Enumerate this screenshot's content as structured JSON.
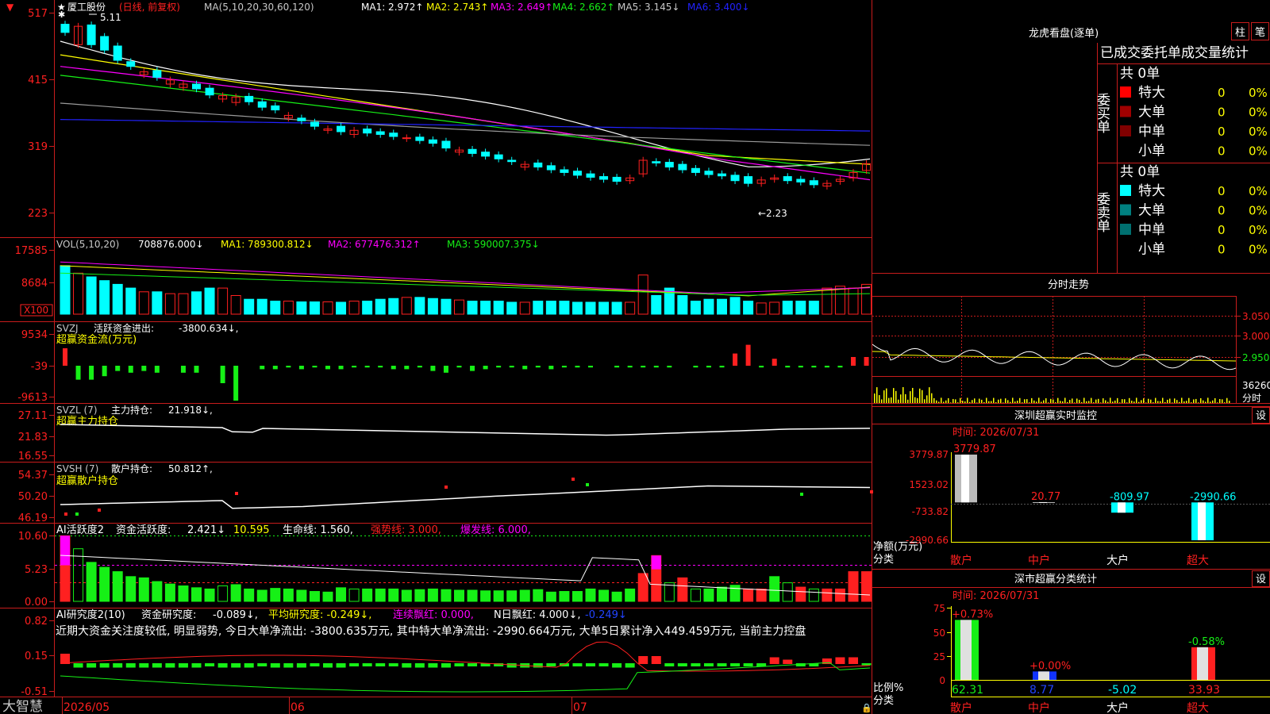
{
  "app": {
    "brand": "大智慧"
  },
  "colors": {
    "bg": "#000000",
    "grid": "#c81c1c",
    "up": "#ff2020",
    "down": "#00ffff",
    "green": "#16f016",
    "white": "#ffffff",
    "yellow": "#ffff00",
    "magenta": "#ff00ff",
    "blue": "#2222ff",
    "gray": "#9a9a9a",
    "teal": "#009090"
  },
  "price_panel": {
    "star": "★",
    "stock_name": "厦工股份",
    "period": "(日线, 前复权)",
    "ma_label": "MA(5,10,20,30,60,120)",
    "ma": [
      {
        "name": "MA1:",
        "value": "2.972",
        "arrow": "↑",
        "color": "#ffffff"
      },
      {
        "name": "MA2:",
        "value": "2.743",
        "arrow": "↑",
        "color": "#ffff00"
      },
      {
        "name": "MA3:",
        "value": "2.649",
        "arrow": "↑",
        "color": "#ff00ff"
      },
      {
        "name": "MA4:",
        "value": "2.662",
        "arrow": "↑",
        "color": "#16f016"
      },
      {
        "name": "MA5:",
        "value": "3.145",
        "arrow": "↓",
        "color": "#c8c8c8"
      },
      {
        "name": "MA6:",
        "value": "3.400",
        "arrow": "↓",
        "color": "#2222ff"
      }
    ],
    "y_ticks": [
      "517",
      "415",
      "319",
      "223"
    ],
    "high_label": "5.11",
    "low_label": "←2.23",
    "high_marker": "✱"
  },
  "vol_panel": {
    "label": "VOL(5,10,20)",
    "value": "708876.000↓",
    "ma": [
      {
        "name": "MA1:",
        "value": "789300.812↓",
        "color": "#ffff00"
      },
      {
        "name": "MA2:",
        "value": "677476.312↑",
        "color": "#ff00ff"
      },
      {
        "name": "MA3:",
        "value": "590007.375↓",
        "color": "#16f016"
      }
    ],
    "y_ticks": [
      "17585",
      "8684"
    ],
    "unit": "X100"
  },
  "svzj_panel": {
    "label": "SVZJ",
    "title": "活跃资金进出:",
    "value": "-3800.634↓,",
    "sub": "超赢资金流(万元)",
    "y_ticks": [
      "9534",
      "-39",
      "-9613"
    ]
  },
  "svzl_panel": {
    "label": "SVZL (7)",
    "title": "主力持仓:",
    "value": "21.918↓,",
    "sub": "超赢主力持仓",
    "y_ticks": [
      "27.11",
      "21.83",
      "16.55"
    ]
  },
  "svsh_panel": {
    "label": "SVSH (7)",
    "title": "散户持仓:",
    "value": "50.812↑,",
    "sub": "超赢散户持仓",
    "y_ticks": [
      "54.37",
      "50.20",
      "46.19"
    ]
  },
  "ai1_panel": {
    "label": "AI活跃度2",
    "title": "资金活跃度:",
    "v1": "2.421↓",
    "v2": "10.595",
    "life": "生命线: 1.560,",
    "strong": "强势线: 3.000,",
    "burst": "爆发线: 6.000,",
    "y_ticks": [
      "10.60",
      "5.23",
      "0.00"
    ]
  },
  "ai2_panel": {
    "label": "AI研究度2(10)",
    "title": "资金研究度:",
    "v1": "-0.089↓,",
    "avg": "平均研究度: -0.249↓,",
    "red": "连续飘红: 0.000,",
    "nred": "N日飘红: 4.000↓,",
    "tail": "-0.249↓",
    "comment": "近期大资金关注度较低, 明显弱势, 今日大单净流出: -3800.635万元, 其中特大单净流出: -2990.664万元, 大单5日累计净入449.459万元, 当前主力控盘",
    "y_ticks": [
      "0.82",
      "0.15",
      "-0.51"
    ]
  },
  "x_axis": {
    "labels": [
      "2026/05",
      "06",
      "07"
    ]
  },
  "dragon": {
    "title": "龙虎看盘(逐单)",
    "btn_bar": "柱",
    "btn_pen": "笔",
    "header": "已成交委托单成交量统计",
    "buy": {
      "label": "委买单",
      "total": "共 0单",
      "rows": [
        {
          "name": "特大",
          "qty": "0",
          "pct": "0%",
          "color": "#ff0000"
        },
        {
          "name": "大单",
          "qty": "0",
          "pct": "0%",
          "color": "#a00000"
        },
        {
          "name": "中单",
          "qty": "0",
          "pct": "0%",
          "color": "#800000"
        },
        {
          "name": "小单",
          "qty": "0",
          "pct": "0%",
          "color": ""
        }
      ]
    },
    "sell": {
      "label": "委卖单",
      "total": "共 0单",
      "rows": [
        {
          "name": "特大",
          "qty": "0",
          "pct": "0%",
          "color": "#00ffff"
        },
        {
          "name": "大单",
          "qty": "0",
          "pct": "0%",
          "color": "#008080"
        },
        {
          "name": "中单",
          "qty": "0",
          "pct": "0%",
          "color": "#007070"
        },
        {
          "name": "小单",
          "qty": "0",
          "pct": "0%",
          "color": ""
        }
      ]
    }
  },
  "intraday": {
    "title": "分时走势",
    "prices": [
      "3.050",
      "3.000",
      "2.950"
    ],
    "vol": "36260",
    "vol_label": "分时"
  },
  "sz_monitor": {
    "title": "深圳超赢实时监控",
    "btn": "设",
    "time": "时间: 2026/07/31",
    "y_ticks": [
      "3779.87",
      "1523.02",
      "-733.82",
      "-2990.66"
    ],
    "y_label": "净额(万元)",
    "x_label": "分类",
    "categories": [
      "散户",
      "中户",
      "大户",
      "超大"
    ],
    "values": [
      "3779.87",
      "20.77",
      "-809.97",
      "-2990.66"
    ]
  },
  "sz_class": {
    "title": "深市超赢分类统计",
    "btn": "设",
    "time": "时间: 2026/07/31",
    "y_ticks": [
      "75",
      "50",
      "25",
      "0"
    ],
    "y_label": "比例%",
    "x_label": "分类",
    "categories": [
      "散户",
      "中户",
      "大户",
      "超大"
    ],
    "values": [
      "62.31",
      "8.77",
      "-5.02",
      "33.93"
    ],
    "changes": [
      "+0.73%",
      "+0.00%",
      "",
      "-0.58%"
    ]
  },
  "chart_data": {
    "type": "candlestick",
    "title": "厦工股份 (日线, 前复权)",
    "x_labels": [
      "2026/05",
      "06",
      "07"
    ],
    "y_ticks": [
      "517",
      "415",
      "319",
      "223"
    ],
    "high": 5.11,
    "low": 2.23,
    "moving_averages": {
      "MA5": 2.972,
      "MA10": 2.743,
      "MA20": 2.649,
      "MA30": 2.662,
      "MA60": 3.145,
      "MA120": 3.4
    }
  }
}
